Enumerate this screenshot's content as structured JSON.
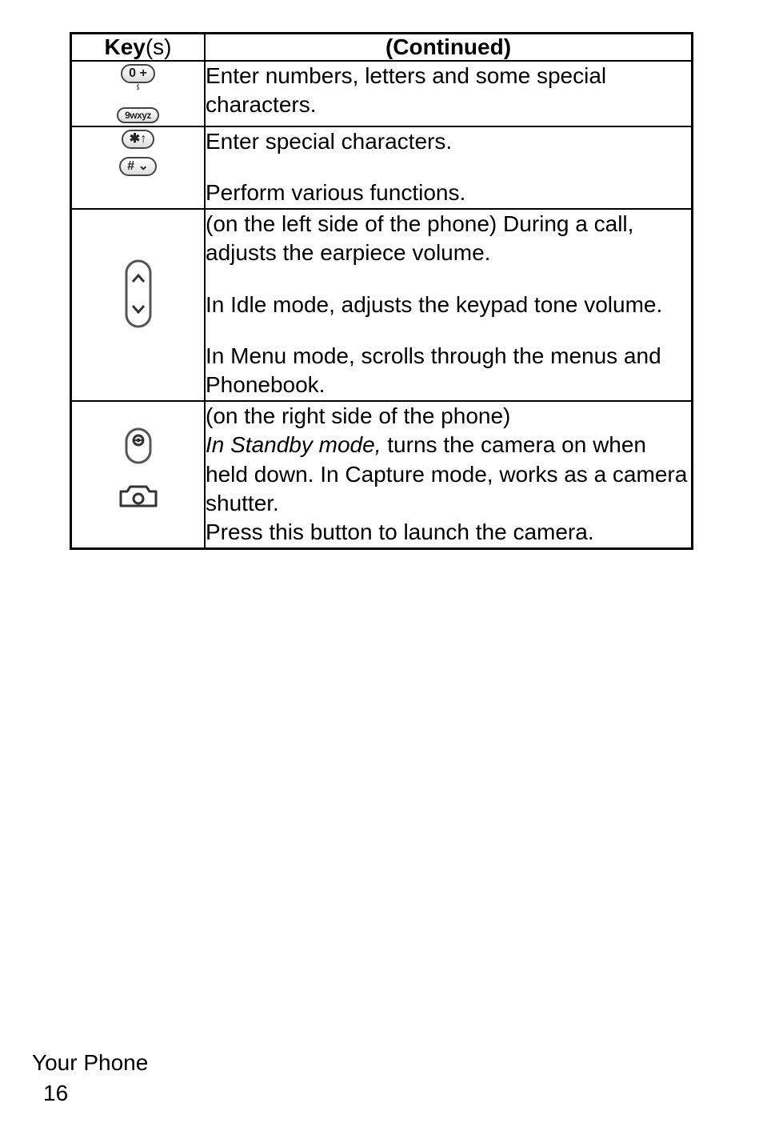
{
  "table": {
    "header": {
      "key_label": "Key",
      "key_s": "(s)",
      "continued": "(Continued)"
    },
    "rows": [
      {
        "icon": "numeric-keys-icon",
        "key_top": "0 +",
        "key_bottom": "9wxyz",
        "desc": {
          "p1": "Enter numbers, letters and some special characters."
        }
      },
      {
        "icon": "star-hash-keys-icon",
        "key_top": "✱↑",
        "key_bottom": "# ⌄",
        "desc": {
          "p1": "Enter special characters.",
          "p2": "Perform various functions."
        }
      },
      {
        "icon": "volume-rocker-icon",
        "desc": {
          "p1": "(on the left side of the phone) During a call, adjusts the earpiece volume.",
          "p2": "In Idle mode, adjusts the keypad tone volume.",
          "p3": "In Menu mode, scrolls through the menus and Phonebook."
        }
      },
      {
        "icon": "camera-keys-icon",
        "desc": {
          "p1": "(on the right side of the phone)",
          "p2_italic": "In Standby mode,",
          "p2_rest": " turns the camera on when held down. In Capture mode, works as a camera shutter.",
          "p3": "Press this button to launch the camera."
        }
      }
    ]
  },
  "footer": {
    "section": "Your Phone",
    "page": "16"
  }
}
